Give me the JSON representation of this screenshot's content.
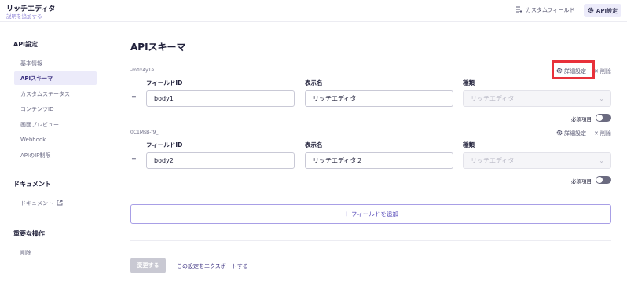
{
  "header": {
    "title": "リッチエディタ",
    "description_link": "説明を追加する",
    "custom_field_label": "カスタムフィールド",
    "api_settings_label": "API設定",
    "custom_field_icon": "list-plus-icon",
    "api_settings_icon": "gear-icon"
  },
  "sidebar": {
    "section_api": "API設定",
    "api_items": [
      {
        "label": "基本情報"
      },
      {
        "label": "APIスキーマ",
        "active": true
      },
      {
        "label": "カスタムステータス"
      },
      {
        "label": "コンテンツID"
      },
      {
        "label": "画面プレビュー"
      },
      {
        "label": "Webhook"
      },
      {
        "label": "APIのIP制限"
      }
    ],
    "section_docs": "ドキュメント",
    "docs_item": "ドキュメント",
    "docs_icon": "external-link-icon",
    "section_danger": "重要な操作",
    "danger_item": "削除"
  },
  "main": {
    "title": "APIスキーマ",
    "fields": [
      {
        "small_id": "-mfix4y1e",
        "field_id_label": "フィールドID",
        "field_id_value": "body1",
        "display_name_label": "表示名",
        "display_name_value": "リッチエディタ",
        "type_label": "種類",
        "type_value": "リッチエディタ",
        "detail_label": "詳細設定",
        "delete_label": "削除",
        "required_label": "必須項目"
      },
      {
        "small_id": "0C1MsB-f9_",
        "field_id_label": "フィールドID",
        "field_id_value": "body2",
        "display_name_label": "表示名",
        "display_name_value": "リッチエディタ２",
        "type_label": "種類",
        "type_value": "リッチエディタ",
        "detail_label": "詳細設定",
        "delete_label": "削除",
        "required_label": "必須項目"
      }
    ],
    "add_field_label": "＋ フィールドを追加",
    "save_label": "変更する",
    "export_label": "この設定をエクスポートする"
  },
  "colors": {
    "accent": "#4c3fb4",
    "highlight": "#e8313a"
  }
}
